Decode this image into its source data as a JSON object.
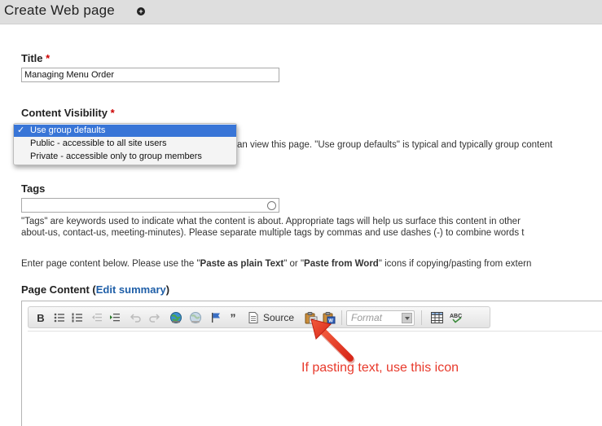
{
  "header": {
    "title": "Create Web page",
    "add_icon": "plus-circle-icon"
  },
  "title_field": {
    "label": "Title",
    "required_mark": "*",
    "value": "Managing Menu Order"
  },
  "visibility": {
    "label": "Content Visibility",
    "required_mark": "*",
    "options": [
      "Use group defaults",
      "Public - accessible to all site users",
      "Private - accessible only to group members"
    ],
    "selected_index": 0,
    "check_mark": "✓",
    "help_text": "an view this page. \"Use group defaults\" is typical and typically group content"
  },
  "tags": {
    "label": "Tags",
    "value": "",
    "help_prefix": "\"Tags\" are keywords used to indicate what the content is about. Appropriate tags will help us surface this content in other",
    "help_line2": "about-us, contact-us, meeting-minutes). Please separate multiple tags by commas and use dashes (-) to combine words t"
  },
  "intro": {
    "part1": "Enter page content below. Please use the \"",
    "bold1": "Paste as plain Text",
    "part2": "\" or \"",
    "bold2": "Paste from Word",
    "part3": "\" icons if copying/pasting from extern"
  },
  "page_content": {
    "label": "Page Content",
    "paren_open": "(",
    "edit_summary": "Edit summary",
    "paren_close": ")"
  },
  "toolbar": {
    "bold": "B",
    "source": "Source",
    "format_placeholder": "Format",
    "quote": "”",
    "icons": [
      "bold-icon",
      "bullet-list-icon",
      "numbered-list-icon",
      "outdent-icon",
      "indent-icon",
      "undo-icon",
      "redo-icon",
      "link-icon",
      "unlink-icon",
      "anchor-flag-icon",
      "blockquote-icon",
      "source-icon",
      "paste-text-icon",
      "paste-word-icon",
      "table-icon",
      "spellcheck-icon"
    ]
  },
  "annotation": {
    "text": "If pasting text, use this icon",
    "color": "#e8392b"
  },
  "colors": {
    "accent": "#3875d7",
    "link": "#1f5fa8",
    "required": "#cc0000"
  }
}
